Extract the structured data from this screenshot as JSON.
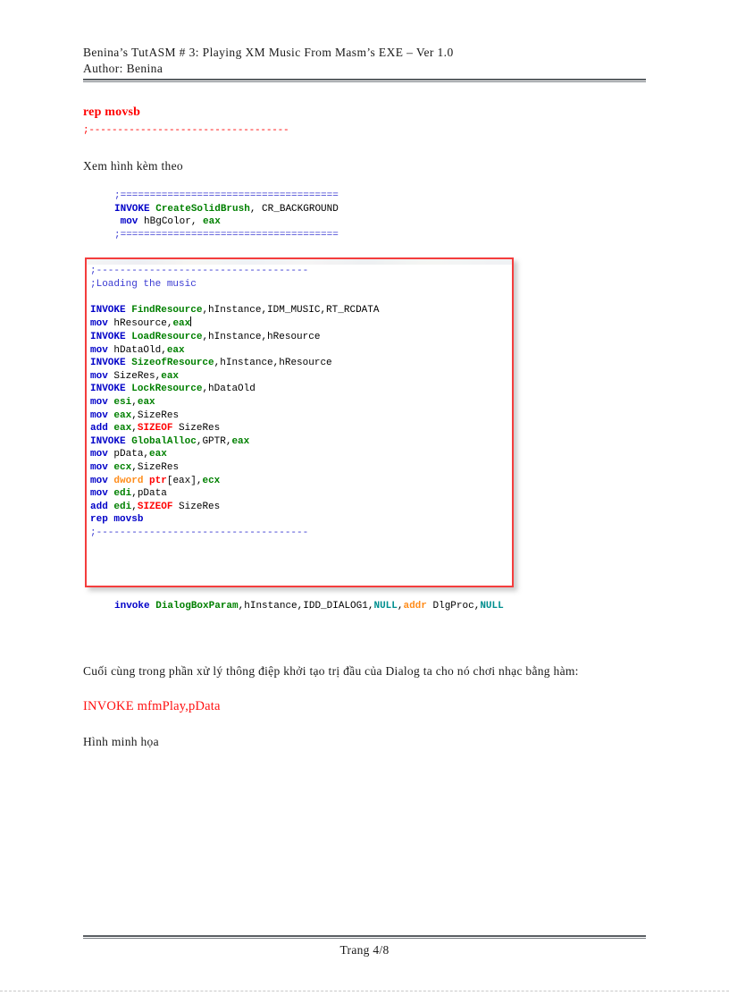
{
  "document": {
    "header": {
      "title_line": "Benina’s  TutASM # 3: Playing  XM Music  From  Masm’s  EXE – Ver 1.0",
      "author_line": "Author:  Benina"
    },
    "footer": {
      "page_label": "Trang 4/8"
    },
    "body": {
      "red_code_top": "rep movsb",
      "red_dashes": ";-----------------------------------",
      "see_figure": "Xem hình kèm theo",
      "paragraph": "Cuối cùng trong phần xử lý thông điệp khởi tạo trị đầu của Dialog  ta cho nó chơi nhạc bằng hàm:",
      "invoke_play": "INVOKE mfmPlay,pData",
      "illustration": "Hình minh họa"
    }
  },
  "code_snippet_top": {
    "lines": [
      [
        {
          "t": ";=====================================",
          "c": "cmt"
        }
      ],
      [
        {
          "t": "INVOKE",
          "c": "kw"
        },
        {
          "t": " ",
          "c": "plain"
        },
        {
          "t": "CreateSolidBrush",
          "c": "api"
        },
        {
          "t": ", CR_BACKGROUND",
          "c": "plain"
        }
      ],
      [
        {
          "t": " ",
          "c": "plain"
        },
        {
          "t": "mov",
          "c": "kw"
        },
        {
          "t": " hBgColor, ",
          "c": "plain"
        },
        {
          "t": "eax",
          "c": "reg"
        }
      ],
      [
        {
          "t": ";=====================================",
          "c": "cmt"
        }
      ]
    ]
  },
  "code_box": {
    "border_color": "#f43d3d",
    "lines": [
      [
        {
          "t": ";------------------------------------",
          "c": "cmt"
        }
      ],
      [
        {
          "t": ";Loading the music",
          "c": "cmt"
        }
      ],
      [
        {
          "t": "",
          "c": "plain"
        }
      ],
      [
        {
          "t": "INVOKE",
          "c": "kw"
        },
        {
          "t": " ",
          "c": "plain"
        },
        {
          "t": "FindResource",
          "c": "api"
        },
        {
          "t": ",hInstance,IDM_MUSIC,RT_RCDATA",
          "c": "plain"
        }
      ],
      [
        {
          "t": "mov",
          "c": "kw"
        },
        {
          "t": " hResource,",
          "c": "plain"
        },
        {
          "t": "eax",
          "c": "reg"
        },
        {
          "t": "|",
          "c": "caret"
        }
      ],
      [
        {
          "t": "INVOKE",
          "c": "kw"
        },
        {
          "t": " ",
          "c": "plain"
        },
        {
          "t": "LoadResource",
          "c": "api"
        },
        {
          "t": ",hInstance,hResource",
          "c": "plain"
        }
      ],
      [
        {
          "t": "mov",
          "c": "kw"
        },
        {
          "t": " hDataOld,",
          "c": "plain"
        },
        {
          "t": "eax",
          "c": "reg"
        }
      ],
      [
        {
          "t": "INVOKE",
          "c": "kw"
        },
        {
          "t": " ",
          "c": "plain"
        },
        {
          "t": "SizeofResource",
          "c": "api"
        },
        {
          "t": ",hInstance,hResource",
          "c": "plain"
        }
      ],
      [
        {
          "t": "mov",
          "c": "kw"
        },
        {
          "t": " SizeRes,",
          "c": "plain"
        },
        {
          "t": "eax",
          "c": "reg"
        }
      ],
      [
        {
          "t": "INVOKE",
          "c": "kw"
        },
        {
          "t": " ",
          "c": "plain"
        },
        {
          "t": "LockResource",
          "c": "api"
        },
        {
          "t": ",hDataOld",
          "c": "plain"
        }
      ],
      [
        {
          "t": "mov",
          "c": "kw"
        },
        {
          "t": " ",
          "c": "plain"
        },
        {
          "t": "esi",
          "c": "reg"
        },
        {
          "t": ",",
          "c": "plain"
        },
        {
          "t": "eax",
          "c": "reg"
        }
      ],
      [
        {
          "t": "mov",
          "c": "kw"
        },
        {
          "t": " ",
          "c": "plain"
        },
        {
          "t": "eax",
          "c": "reg"
        },
        {
          "t": ",SizeRes",
          "c": "plain"
        }
      ],
      [
        {
          "t": "add",
          "c": "kw"
        },
        {
          "t": " ",
          "c": "plain"
        },
        {
          "t": "eax",
          "c": "reg"
        },
        {
          "t": ",",
          "c": "plain"
        },
        {
          "t": "SIZEOF",
          "c": "sizeof"
        },
        {
          "t": " SizeRes",
          "c": "plain"
        }
      ],
      [
        {
          "t": "INVOKE",
          "c": "kw"
        },
        {
          "t": " ",
          "c": "plain"
        },
        {
          "t": "GlobalAlloc",
          "c": "api"
        },
        {
          "t": ",GPTR,",
          "c": "plain"
        },
        {
          "t": "eax",
          "c": "reg"
        }
      ],
      [
        {
          "t": "mov",
          "c": "kw"
        },
        {
          "t": " pData,",
          "c": "plain"
        },
        {
          "t": "eax",
          "c": "reg"
        }
      ],
      [
        {
          "t": "mov",
          "c": "kw"
        },
        {
          "t": " ",
          "c": "plain"
        },
        {
          "t": "ecx",
          "c": "reg"
        },
        {
          "t": ",SizeRes",
          "c": "plain"
        }
      ],
      [
        {
          "t": "mov",
          "c": "kw"
        },
        {
          "t": " ",
          "c": "plain"
        },
        {
          "t": "dword",
          "c": "dword"
        },
        {
          "t": " ",
          "c": "plain"
        },
        {
          "t": "ptr",
          "c": "sizeof"
        },
        {
          "t": "[eax],",
          "c": "plain"
        },
        {
          "t": "ecx",
          "c": "reg"
        }
      ],
      [
        {
          "t": "mov",
          "c": "kw"
        },
        {
          "t": " ",
          "c": "plain"
        },
        {
          "t": "edi",
          "c": "reg"
        },
        {
          "t": ",pData",
          "c": "plain"
        }
      ],
      [
        {
          "t": "add",
          "c": "kw"
        },
        {
          "t": " ",
          "c": "plain"
        },
        {
          "t": "edi",
          "c": "reg"
        },
        {
          "t": ",",
          "c": "plain"
        },
        {
          "t": "SIZEOF",
          "c": "sizeof"
        },
        {
          "t": " SizeRes",
          "c": "plain"
        }
      ],
      [
        {
          "t": "rep",
          "c": "kw"
        },
        {
          "t": " ",
          "c": "plain"
        },
        {
          "t": "movsb",
          "c": "kw"
        }
      ],
      [
        {
          "t": ";------------------------------------",
          "c": "cmt"
        }
      ]
    ]
  },
  "code_snippet_bottom": {
    "lines": [
      [
        {
          "t": "invoke",
          "c": "kw"
        },
        {
          "t": " ",
          "c": "plain"
        },
        {
          "t": "DialogBoxParam",
          "c": "api"
        },
        {
          "t": ",hInstance,IDD_DIALOG1,",
          "c": "plain"
        },
        {
          "t": "NULL",
          "c": "nullv"
        },
        {
          "t": ",",
          "c": "plain"
        },
        {
          "t": "addr",
          "c": "dword"
        },
        {
          "t": " DlgProc,",
          "c": "plain"
        },
        {
          "t": "NULL",
          "c": "nullv"
        }
      ]
    ]
  }
}
